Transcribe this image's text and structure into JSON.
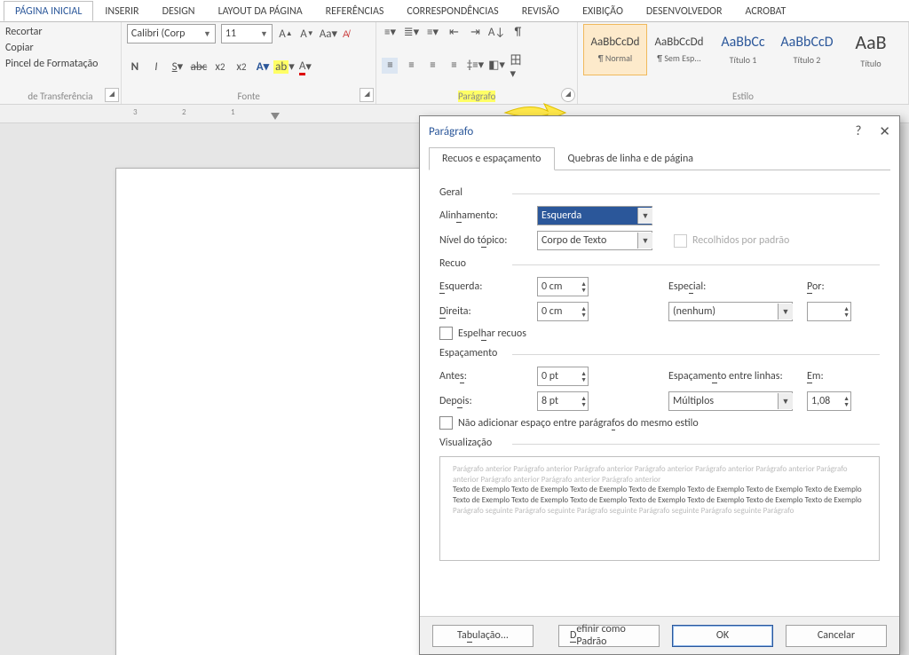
{
  "tabs": {
    "home": "PÁGINA INICIAL",
    "insert": "INSERIR",
    "design": "DESIGN",
    "layout": "LAYOUT DA PÁGINA",
    "references": "REFERÊNCIAS",
    "mailings": "CORRESPONDÊNCIAS",
    "review": "REVISÃO",
    "view": "EXIBIÇÃO",
    "developer": "DESENVOLVEDOR",
    "acrobat": "ACROBAT"
  },
  "clipboard": {
    "cut": "Recortar",
    "copy": "Copiar",
    "painter": "Pincel de Formatação",
    "group": "de Transferência"
  },
  "font": {
    "name": "Calibri (Corp",
    "size": "11",
    "group": "Fonte"
  },
  "paragraph": {
    "group": "Parágrafo"
  },
  "styles": {
    "group": "Estilo",
    "list": [
      {
        "sample": "AaBbCcDd",
        "name": "¶ Normal",
        "color": "#444"
      },
      {
        "sample": "AaBbCcDd",
        "name": "¶ Sem Esp...",
        "color": "#444"
      },
      {
        "sample": "AaBbCc",
        "name": "Título 1",
        "color": "#2b579a"
      },
      {
        "sample": "AaBbCcD",
        "name": "Título 2",
        "color": "#2b579a"
      },
      {
        "sample": "AaB",
        "name": "Título",
        "color": "#444"
      }
    ]
  },
  "ruler": {
    "n3": "3",
    "n2": "2",
    "n1": "1"
  },
  "dialog": {
    "title": "Parágrafo",
    "help": "?",
    "close": "✕",
    "tabs": {
      "t1": "Recuos e espaçamento",
      "t2": "Quebras de linha e de página"
    },
    "general": {
      "title": "Geral",
      "align_lbl": "Alinhamento:",
      "align_val": "Esquerda",
      "outline_lbl": "Nível do tópico:",
      "outline_val": "Corpo de Texto",
      "collapsed": "Recolhidos por padrão"
    },
    "indent": {
      "title": "Recuo",
      "left_lbl": "Esquerda:",
      "left_val": "0 cm",
      "right_lbl": "Direita:",
      "right_val": "0 cm",
      "special_lbl": "Especial:",
      "special_val": "(nenhum)",
      "by_lbl": "Por:",
      "by_val": "",
      "mirror": "Espelhar recuos"
    },
    "spacing": {
      "title": "Espaçamento",
      "before_lbl": "Antes:",
      "before_val": "0 pt",
      "after_lbl": "Depois:",
      "after_val": "8 pt",
      "line_lbl": "Espaçamento entre linhas:",
      "line_val": "Múltiplos",
      "at_lbl": "Em:",
      "at_val": "1,08",
      "nospace": "Não adicionar espaço entre parágrafos do mesmo estilo"
    },
    "preview": {
      "title": "Visualização",
      "prev": "Parágrafo anterior Parágrafo anterior Parágrafo anterior Parágrafo anterior Parágrafo anterior Parágrafo anterior Parágrafo anterior Parágrafo anterior Parágrafo anterior Parágrafo anterior",
      "sample": "Texto de Exemplo Texto de Exemplo Texto de Exemplo Texto de Exemplo Texto de Exemplo Texto de Exemplo Texto de Exemplo Texto de Exemplo Texto de Exemplo Texto de Exemplo Texto de Exemplo Texto de Exemplo Texto de Exemplo Texto de Exemplo",
      "next": "Parágrafo seguinte Parágrafo seguinte Parágrafo seguinte Parágrafo seguinte Parágrafo seguinte Parágrafo"
    },
    "buttons": {
      "tabs": "Tabulação...",
      "default": "Definir como Padrão",
      "ok": "OK",
      "cancel": "Cancelar"
    }
  }
}
